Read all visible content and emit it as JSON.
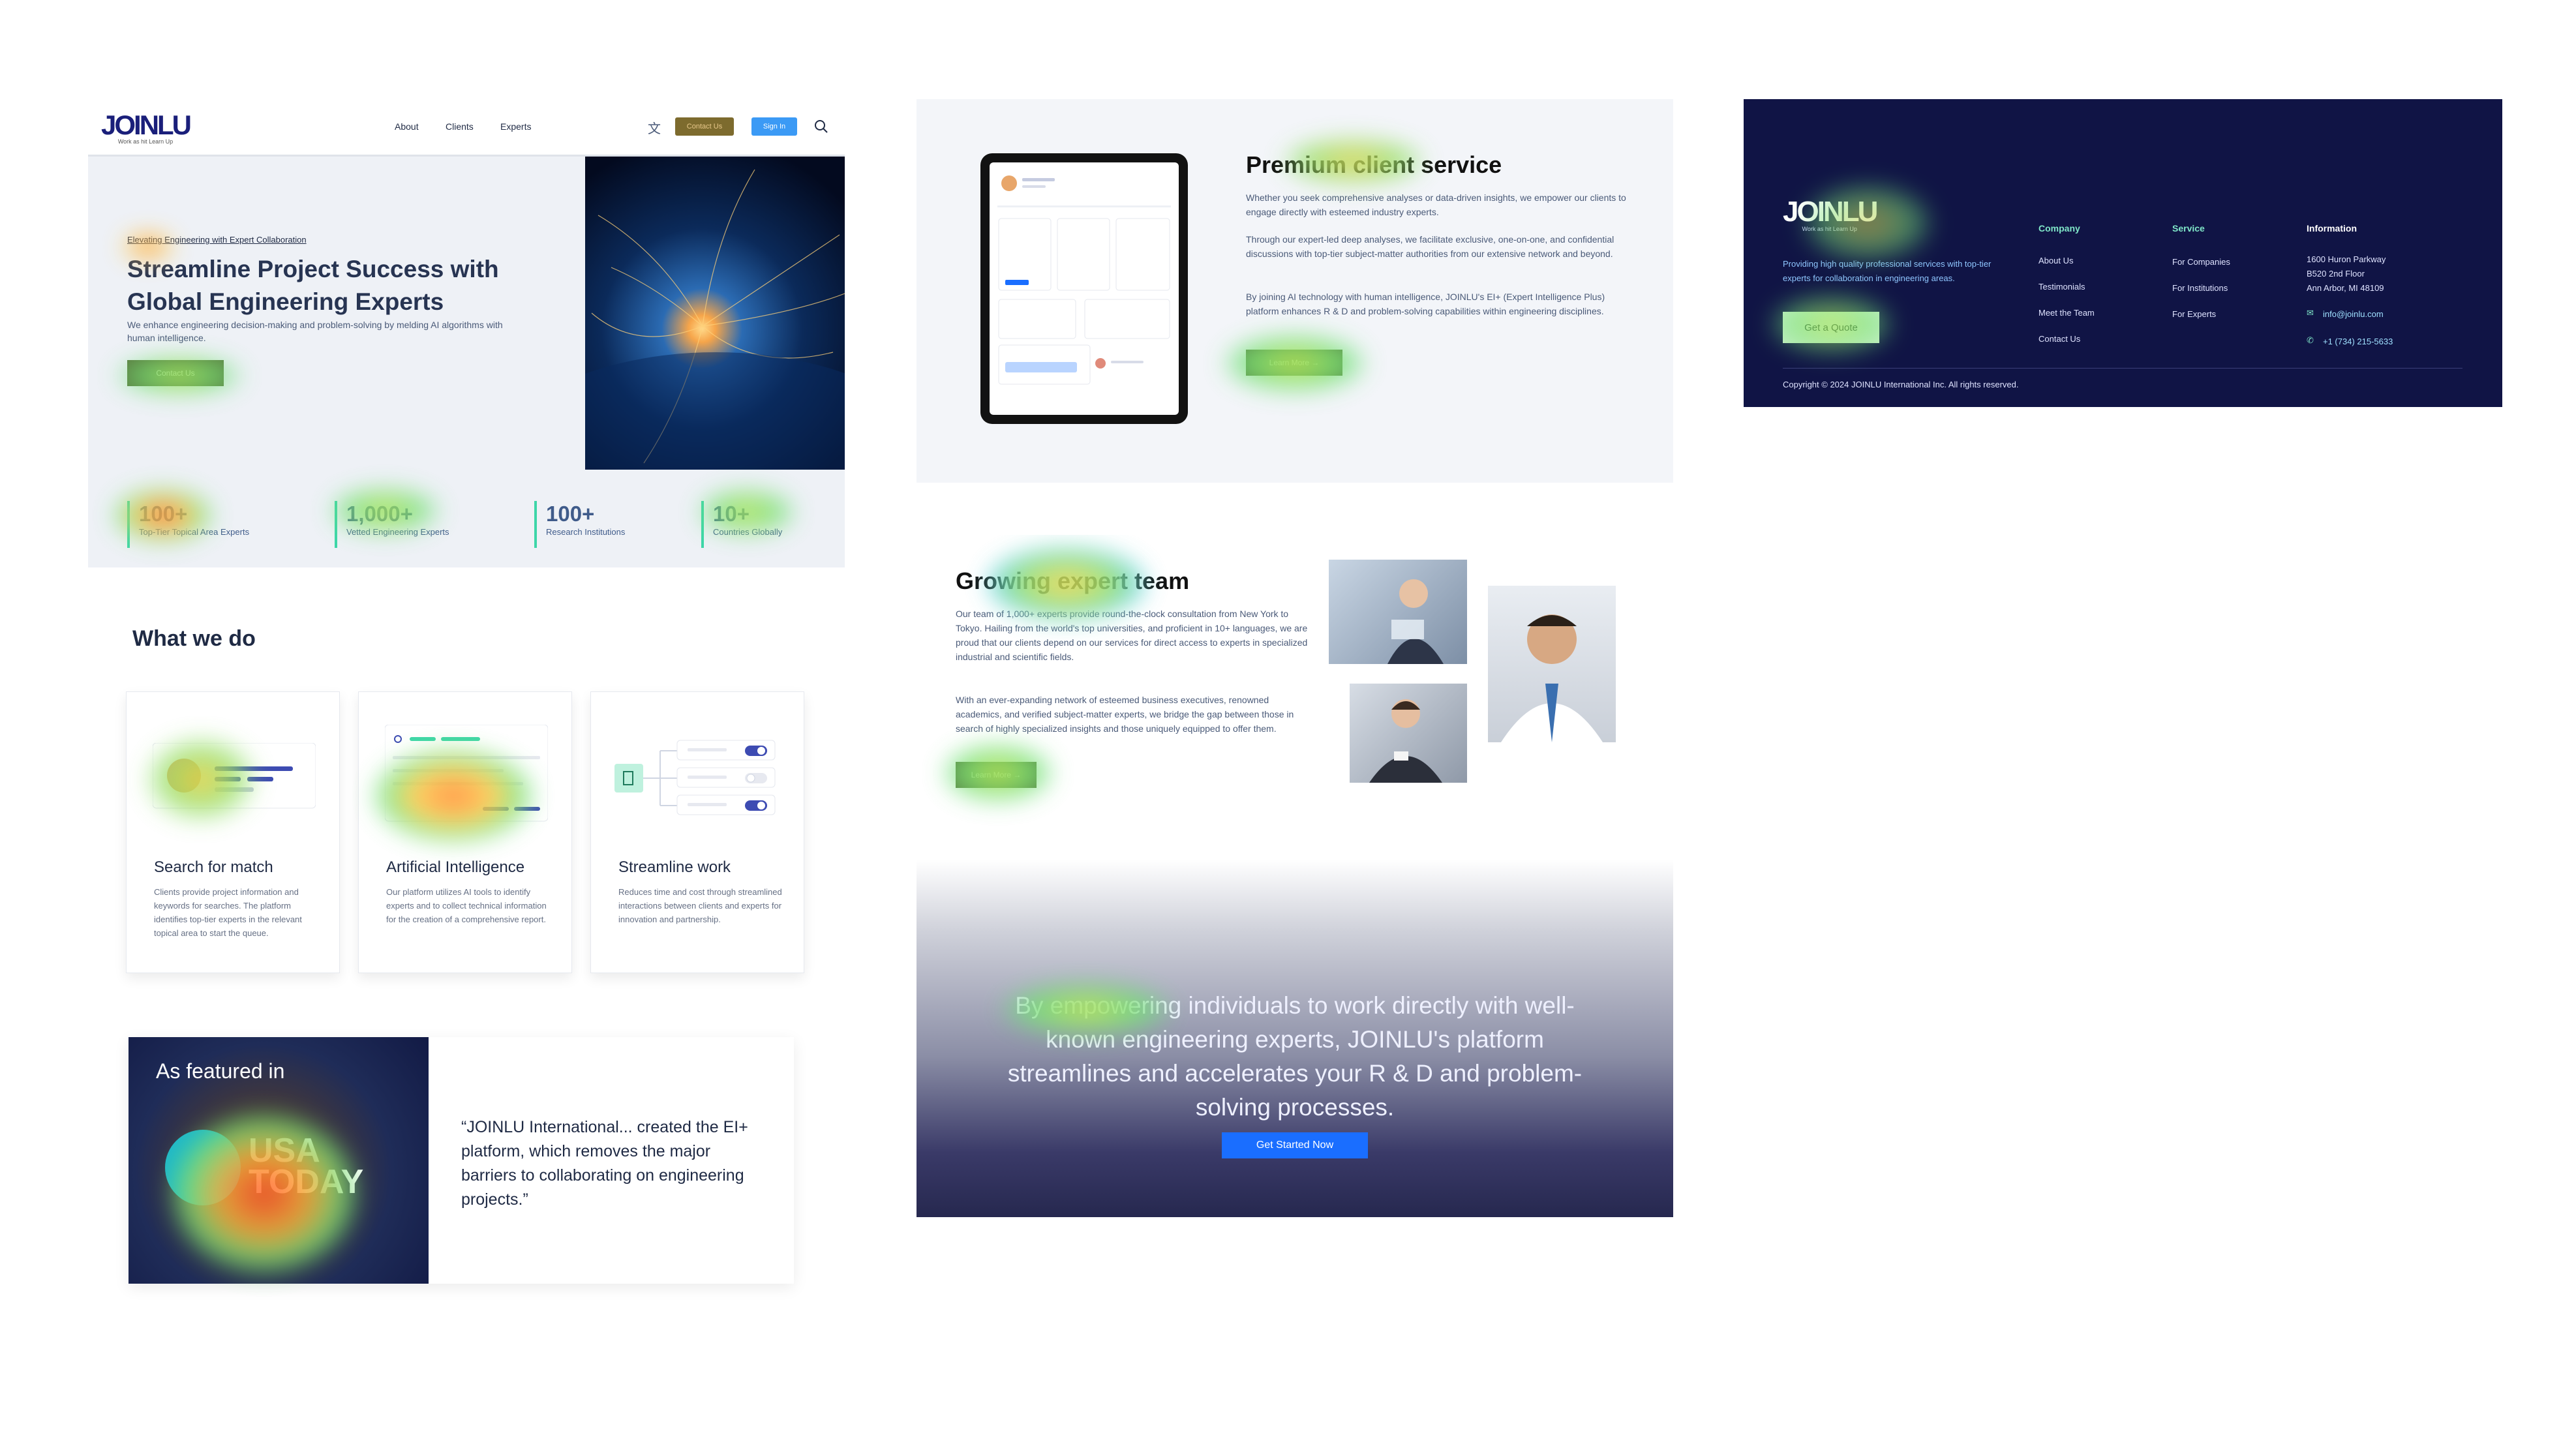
{
  "panel1": {
    "logo": {
      "text": "JOINLU",
      "tagline": "Work as hit Learn Up"
    },
    "nav": {
      "about": "About",
      "clients": "Clients",
      "experts": "Experts",
      "contact": "Contact Us",
      "signin": "Sign In"
    },
    "hero": {
      "kicker": "Elevating Engineering with Expert Collaboration",
      "title": "Streamline Project Success with Global Engineering Experts",
      "body": "We enhance engineering decision-making and problem-solving by melding AI algorithms with human intelligence.",
      "cta": "Contact Us"
    },
    "stats": [
      {
        "value": "100+",
        "label": "Top-Tier Topical Area Experts"
      },
      {
        "value": "1,000+",
        "label": "Vetted Engineering Experts"
      },
      {
        "value": "100+",
        "label": "Research Institutions"
      },
      {
        "value": "10+",
        "label": "Countries Globally"
      }
    ],
    "what_we_do": "What we do",
    "cards": [
      {
        "title": "Search for match",
        "body": "Clients provide project information and keywords for searches. The platform identifies top-tier experts in the relevant topical area to start the queue."
      },
      {
        "title": "Artificial Intelligence",
        "body": "Our platform utilizes AI tools to identify experts and to collect technical information for the creation of a comprehensive report."
      },
      {
        "title": "Streamline work",
        "body": "Reduces time and cost through streamlined interactions between clients and experts for innovation and partnership."
      }
    ],
    "featured": {
      "heading": "As featured in",
      "brand_line1": "USA",
      "brand_line2": "TODAY",
      "quote": "“JOINLU International... created the EI+ platform, which removes the major barriers to collaborating on engineering projects.”"
    }
  },
  "panel2": {
    "premium": {
      "title": "Premium client service",
      "p1": "Whether you seek comprehensive analyses or data-driven insights, we empower our clients to engage directly with esteemed industry experts.",
      "p2": "Through our expert-led deep analyses, we facilitate exclusive, one-on-one, and confidential discussions with top-tier subject-matter authorities from our extensive network and beyond.",
      "p3": "By joining AI technology with human intelligence, JOINLU's EI+ (Expert Intelligence Plus) platform enhances R & D and problem-solving capabilities within engineering disciplines.",
      "cta": "Learn More →"
    },
    "team": {
      "title": "Growing expert team",
      "p1": "Our team of 1,000+ experts provide round-the-clock consultation from New York to Tokyo. Hailing from the world's top universities, and proficient in 10+ languages, we are proud that our clients depend on our services for direct access to experts in specialized industrial and scientific fields.",
      "p2": "With an ever-expanding network of esteemed business executives, renowned academics, and verified subject-matter experts, we bridge the gap between those in search of highly specialized insights and those uniquely equipped to offer them.",
      "cta": "Learn More →"
    },
    "banner": {
      "text": "By empowering individuals to work directly with well-known engineering experts, JOINLU's platform streamlines and accelerates your R & D and problem-solving processes.",
      "cta": "Get Started Now"
    }
  },
  "panel3": {
    "logo": "JOINLU",
    "tagline": "Work as hit Learn Up",
    "about": "Providing high quality professional services with top-tier experts for collaboration in engineering areas.",
    "quote_btn": "Get a Quote",
    "company": {
      "heading": "Company",
      "links": [
        "About Us",
        "Testimonials",
        "Meet the Team",
        "Contact Us"
      ]
    },
    "service": {
      "heading": "Service",
      "links": [
        "For Companies",
        "For Institutions",
        "For Experts"
      ]
    },
    "info": {
      "heading": "Information",
      "address1": "1600 Huron Parkway",
      "address2": "B520 2nd Floor",
      "address3": "Ann Arbor, MI 48109",
      "email": "info@joinlu.com",
      "phone": "+1 (734) 215-5633"
    },
    "copyright": "Copyright © 2024 JOINLU International Inc. All rights reserved."
  },
  "colors": {
    "navy": "#101445",
    "accent_green": "#3dd6a8",
    "cta_blue": "#1a6eff",
    "link_blue": "#3b82f6"
  }
}
